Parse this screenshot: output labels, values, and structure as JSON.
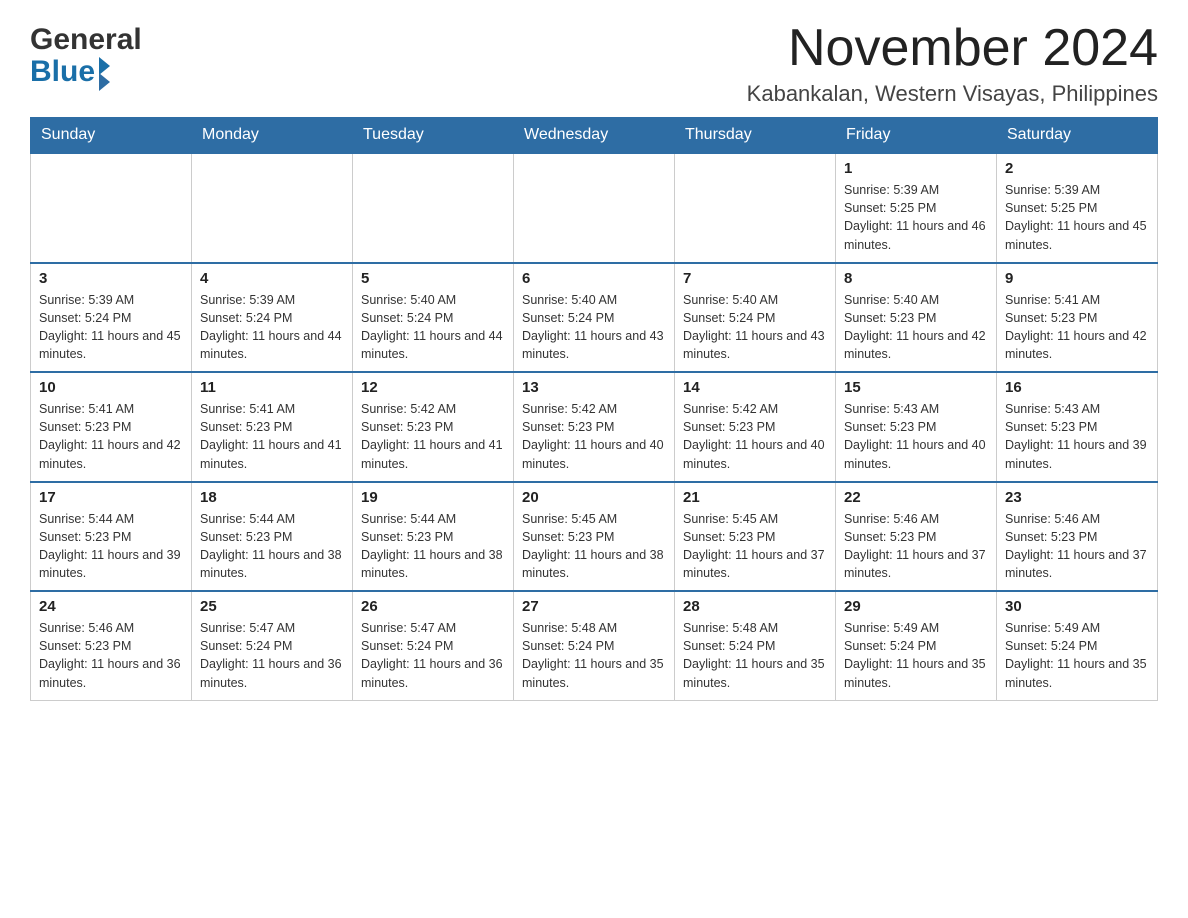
{
  "header": {
    "logo_line1": "General",
    "logo_line2": "Blue",
    "month_title": "November 2024",
    "location": "Kabankalan, Western Visayas, Philippines"
  },
  "days_of_week": [
    "Sunday",
    "Monday",
    "Tuesday",
    "Wednesday",
    "Thursday",
    "Friday",
    "Saturday"
  ],
  "weeks": [
    {
      "days": [
        {
          "number": "",
          "info": ""
        },
        {
          "number": "",
          "info": ""
        },
        {
          "number": "",
          "info": ""
        },
        {
          "number": "",
          "info": ""
        },
        {
          "number": "",
          "info": ""
        },
        {
          "number": "1",
          "info": "Sunrise: 5:39 AM\nSunset: 5:25 PM\nDaylight: 11 hours and 46 minutes."
        },
        {
          "number": "2",
          "info": "Sunrise: 5:39 AM\nSunset: 5:25 PM\nDaylight: 11 hours and 45 minutes."
        }
      ]
    },
    {
      "days": [
        {
          "number": "3",
          "info": "Sunrise: 5:39 AM\nSunset: 5:24 PM\nDaylight: 11 hours and 45 minutes."
        },
        {
          "number": "4",
          "info": "Sunrise: 5:39 AM\nSunset: 5:24 PM\nDaylight: 11 hours and 44 minutes."
        },
        {
          "number": "5",
          "info": "Sunrise: 5:40 AM\nSunset: 5:24 PM\nDaylight: 11 hours and 44 minutes."
        },
        {
          "number": "6",
          "info": "Sunrise: 5:40 AM\nSunset: 5:24 PM\nDaylight: 11 hours and 43 minutes."
        },
        {
          "number": "7",
          "info": "Sunrise: 5:40 AM\nSunset: 5:24 PM\nDaylight: 11 hours and 43 minutes."
        },
        {
          "number": "8",
          "info": "Sunrise: 5:40 AM\nSunset: 5:23 PM\nDaylight: 11 hours and 42 minutes."
        },
        {
          "number": "9",
          "info": "Sunrise: 5:41 AM\nSunset: 5:23 PM\nDaylight: 11 hours and 42 minutes."
        }
      ]
    },
    {
      "days": [
        {
          "number": "10",
          "info": "Sunrise: 5:41 AM\nSunset: 5:23 PM\nDaylight: 11 hours and 42 minutes."
        },
        {
          "number": "11",
          "info": "Sunrise: 5:41 AM\nSunset: 5:23 PM\nDaylight: 11 hours and 41 minutes."
        },
        {
          "number": "12",
          "info": "Sunrise: 5:42 AM\nSunset: 5:23 PM\nDaylight: 11 hours and 41 minutes."
        },
        {
          "number": "13",
          "info": "Sunrise: 5:42 AM\nSunset: 5:23 PM\nDaylight: 11 hours and 40 minutes."
        },
        {
          "number": "14",
          "info": "Sunrise: 5:42 AM\nSunset: 5:23 PM\nDaylight: 11 hours and 40 minutes."
        },
        {
          "number": "15",
          "info": "Sunrise: 5:43 AM\nSunset: 5:23 PM\nDaylight: 11 hours and 40 minutes."
        },
        {
          "number": "16",
          "info": "Sunrise: 5:43 AM\nSunset: 5:23 PM\nDaylight: 11 hours and 39 minutes."
        }
      ]
    },
    {
      "days": [
        {
          "number": "17",
          "info": "Sunrise: 5:44 AM\nSunset: 5:23 PM\nDaylight: 11 hours and 39 minutes."
        },
        {
          "number": "18",
          "info": "Sunrise: 5:44 AM\nSunset: 5:23 PM\nDaylight: 11 hours and 38 minutes."
        },
        {
          "number": "19",
          "info": "Sunrise: 5:44 AM\nSunset: 5:23 PM\nDaylight: 11 hours and 38 minutes."
        },
        {
          "number": "20",
          "info": "Sunrise: 5:45 AM\nSunset: 5:23 PM\nDaylight: 11 hours and 38 minutes."
        },
        {
          "number": "21",
          "info": "Sunrise: 5:45 AM\nSunset: 5:23 PM\nDaylight: 11 hours and 37 minutes."
        },
        {
          "number": "22",
          "info": "Sunrise: 5:46 AM\nSunset: 5:23 PM\nDaylight: 11 hours and 37 minutes."
        },
        {
          "number": "23",
          "info": "Sunrise: 5:46 AM\nSunset: 5:23 PM\nDaylight: 11 hours and 37 minutes."
        }
      ]
    },
    {
      "days": [
        {
          "number": "24",
          "info": "Sunrise: 5:46 AM\nSunset: 5:23 PM\nDaylight: 11 hours and 36 minutes."
        },
        {
          "number": "25",
          "info": "Sunrise: 5:47 AM\nSunset: 5:24 PM\nDaylight: 11 hours and 36 minutes."
        },
        {
          "number": "26",
          "info": "Sunrise: 5:47 AM\nSunset: 5:24 PM\nDaylight: 11 hours and 36 minutes."
        },
        {
          "number": "27",
          "info": "Sunrise: 5:48 AM\nSunset: 5:24 PM\nDaylight: 11 hours and 35 minutes."
        },
        {
          "number": "28",
          "info": "Sunrise: 5:48 AM\nSunset: 5:24 PM\nDaylight: 11 hours and 35 minutes."
        },
        {
          "number": "29",
          "info": "Sunrise: 5:49 AM\nSunset: 5:24 PM\nDaylight: 11 hours and 35 minutes."
        },
        {
          "number": "30",
          "info": "Sunrise: 5:49 AM\nSunset: 5:24 PM\nDaylight: 11 hours and 35 minutes."
        }
      ]
    }
  ]
}
